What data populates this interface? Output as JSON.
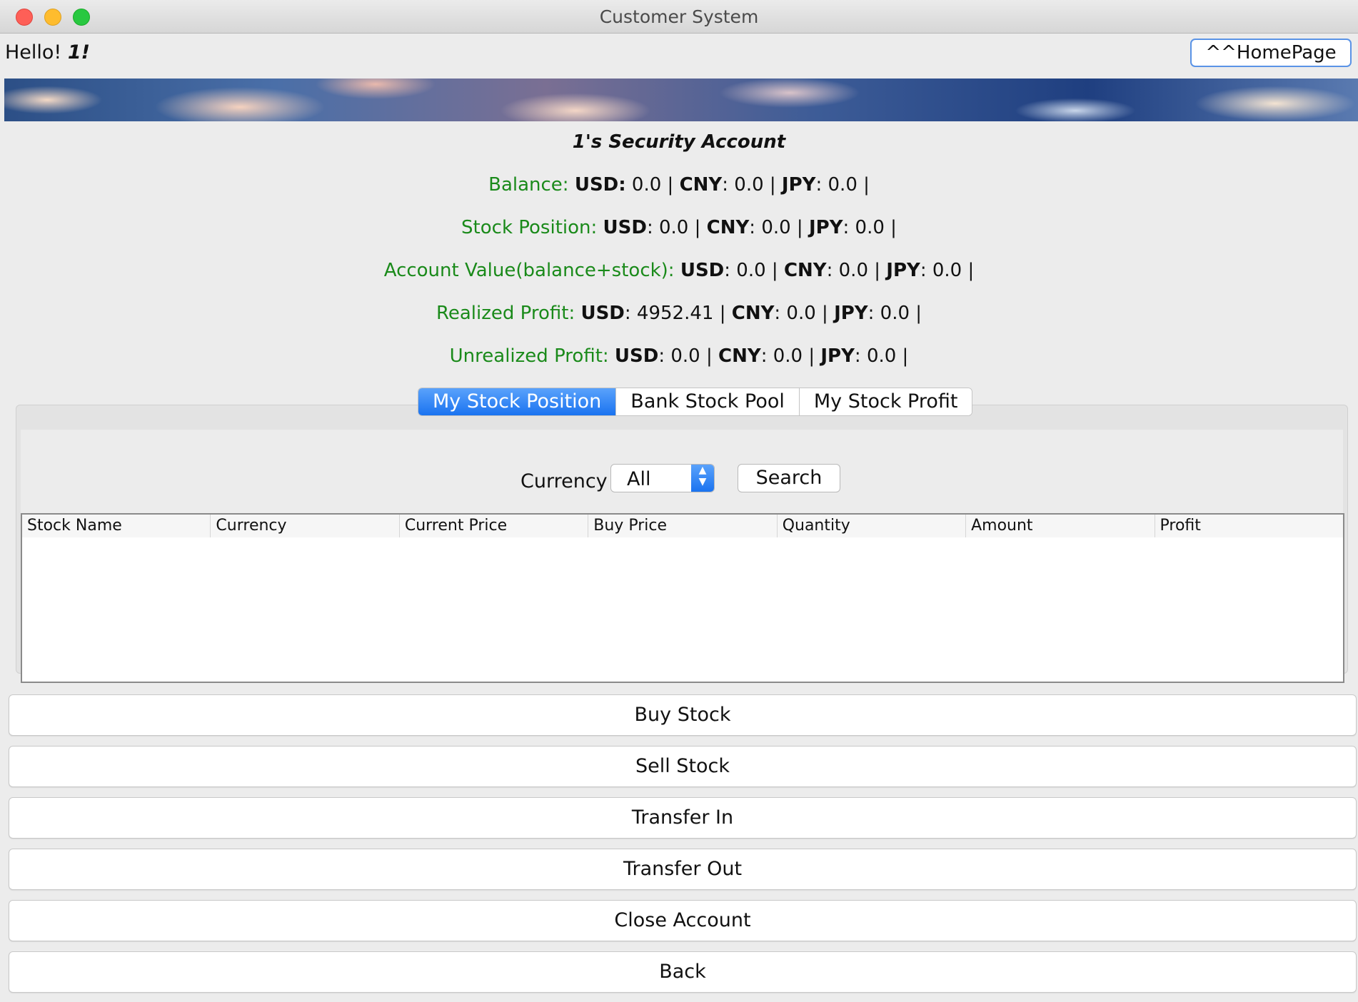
{
  "window": {
    "title": "Customer System"
  },
  "header": {
    "greeting_prefix": "Hello!",
    "user_name": "1!",
    "home_button": "^^HomePage"
  },
  "account": {
    "title": "1's Security Account",
    "rows": [
      {
        "label": "Balance:",
        "usd_key": "USD:",
        "usd": " 0.0 | ",
        "cny_key": "CNY",
        "cny": ": 0.0 | ",
        "jpy_key": "JPY",
        "jpy": ": 0.0 |"
      },
      {
        "label": "Stock Position:",
        "usd_key": "USD",
        "usd": ": 0.0 | ",
        "cny_key": "CNY",
        "cny": ": 0.0 | ",
        "jpy_key": "JPY",
        "jpy": ": 0.0 |"
      },
      {
        "label": "Account Value(balance+stock):",
        "usd_key": "USD",
        "usd": ": 0.0 | ",
        "cny_key": "CNY",
        "cny": ": 0.0 | ",
        "jpy_key": "JPY",
        "jpy": ": 0.0 |"
      },
      {
        "label": "Realized Profit:",
        "usd_key": "USD",
        "usd": ": 4952.41 | ",
        "cny_key": "CNY",
        "cny": ": 0.0 | ",
        "jpy_key": "JPY",
        "jpy": ": 0.0 |"
      },
      {
        "label": "Unrealized Profit:",
        "usd_key": "USD",
        "usd": ": 0.0 | ",
        "cny_key": "CNY",
        "cny": ": 0.0 | ",
        "jpy_key": "JPY",
        "jpy": ": 0.0 |"
      }
    ]
  },
  "tabs": [
    "My Stock Position",
    "Bank Stock Pool",
    "My Stock Profit"
  ],
  "filter": {
    "currency_label": "Currency",
    "currency_value": "All",
    "search_button": "Search"
  },
  "table": {
    "columns": [
      "Stock Name",
      "Currency",
      "Current Price",
      "Buy Price",
      "Quantity",
      "Amount",
      "Profit"
    ]
  },
  "actions": [
    "Buy Stock",
    "Sell Stock",
    "Transfer In",
    "Transfer Out",
    "Close Account",
    "Back"
  ],
  "colors": {
    "label_green": "#1a8a1a",
    "accent_blue": "#1a73f0"
  }
}
